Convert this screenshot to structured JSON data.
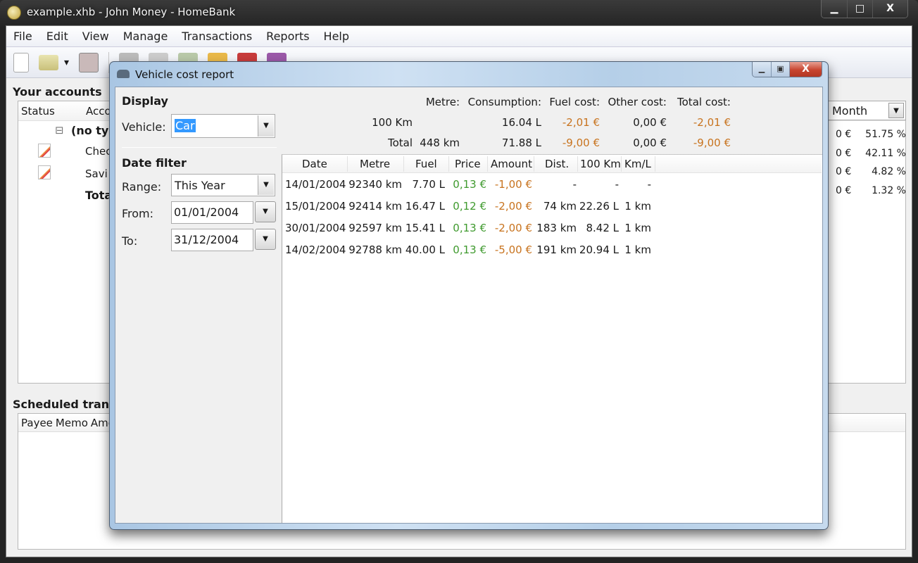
{
  "window": {
    "title": "example.xhb - John Money - HomeBank",
    "controls": {
      "minimize": "▁",
      "maximize": "□",
      "close": "X"
    }
  },
  "menubar": [
    "File",
    "Edit",
    "View",
    "Manage",
    "Transactions",
    "Reports",
    "Help"
  ],
  "toolbar": {
    "icons": [
      "new-file-icon",
      "open-folder-icon",
      "dropdown-arrow-icon",
      "save-icon",
      "accounts-icon",
      "payees-icon",
      "categories-icon",
      "archives-icon",
      "budget-icon",
      "assign-icon",
      "show-transactions-icon",
      "add-transaction-icon",
      "statistics-report-icon",
      "overtime-report-icon",
      "trend-report-icon",
      "budget-report-icon",
      "vehicle-cost-icon"
    ],
    "dropdown_glyph": "▾"
  },
  "accounts": {
    "title": "Your accounts",
    "columns": [
      "Status",
      "Acco"
    ],
    "group": "(no typ",
    "group_toggle": "⊟",
    "rows": [
      {
        "name": "Chec"
      },
      {
        "name": "Savi"
      }
    ],
    "total": "Tota",
    "period": "Month",
    "dd_glyph": "▼",
    "right_values": [
      {
        "amount": "0 €",
        "pct": "51.75 %"
      },
      {
        "amount": "0 €",
        "pct": "42.11 %"
      },
      {
        "amount": "0 €",
        "pct": "4.82 %"
      },
      {
        "amount": "0 €",
        "pct": "1.32 %"
      }
    ]
  },
  "scheduled": {
    "title": "Scheduled transac",
    "columns": [
      "Payee",
      "Memo",
      "Amo"
    ]
  },
  "dialog": {
    "title": "Vehicle cost report",
    "controls": {
      "minimize": "▁",
      "maximize": "▣",
      "close": "X"
    },
    "display": {
      "section": "Display",
      "vehicle_label": "Vehicle:",
      "vehicle_value": "Car"
    },
    "date_filter": {
      "section": "Date filter",
      "range_label": "Range:",
      "range_value": "This Year",
      "from_label": "From:",
      "from_value": "01/01/2004",
      "to_label": "To:",
      "to_value": "31/12/2004"
    },
    "dd_glyph": "▼",
    "summary": {
      "headers": {
        "metre": "Metre:",
        "consumption": "Consumption:",
        "fuel_cost": "Fuel cost:",
        "other_cost": "Other cost:",
        "total_cost": "Total cost:"
      },
      "per100": {
        "label": "100 Km",
        "metre": "",
        "consumption": "16.04 L",
        "fuel_cost": "-2,01 €",
        "other_cost": "0,00 €",
        "total_cost": "-2,01 €"
      },
      "total": {
        "label": "Total",
        "metre": "448 km",
        "consumption": "71.88 L",
        "fuel_cost": "-9,00 €",
        "other_cost": "0,00 €",
        "total_cost": "-9,00 €"
      }
    },
    "table": {
      "columns": [
        "Date",
        "Metre",
        "Fuel",
        "Price",
        "Amount",
        "Dist.",
        "100 Km",
        "Km/L"
      ],
      "rows": [
        {
          "date": "14/01/2004",
          "metre": "92340 km",
          "fuel": "7.70 L",
          "price": "0,13 €",
          "amount": "-1,00 €",
          "dist": "-",
          "per100": "-",
          "kml": "-"
        },
        {
          "date": "15/01/2004",
          "metre": "92414 km",
          "fuel": "16.47 L",
          "price": "0,12 €",
          "amount": "-2,00 €",
          "dist": "74 km",
          "per100": "22.26 L",
          "kml": "1 km"
        },
        {
          "date": "30/01/2004",
          "metre": "92597 km",
          "fuel": "15.41 L",
          "price": "0,13 €",
          "amount": "-2,00 €",
          "dist": "183 km",
          "per100": "8.42 L",
          "kml": "1 km"
        },
        {
          "date": "14/02/2004",
          "metre": "92788 km",
          "fuel": "40.00 L",
          "price": "0,13 €",
          "amount": "-5,00 €",
          "dist": "191 km",
          "per100": "20.94 L",
          "kml": "1 km"
        }
      ]
    }
  },
  "colors": {
    "negative": "#c8731e",
    "price": "#3f9a2e",
    "selection": "#3399ff",
    "close_button": "#c7442f"
  }
}
